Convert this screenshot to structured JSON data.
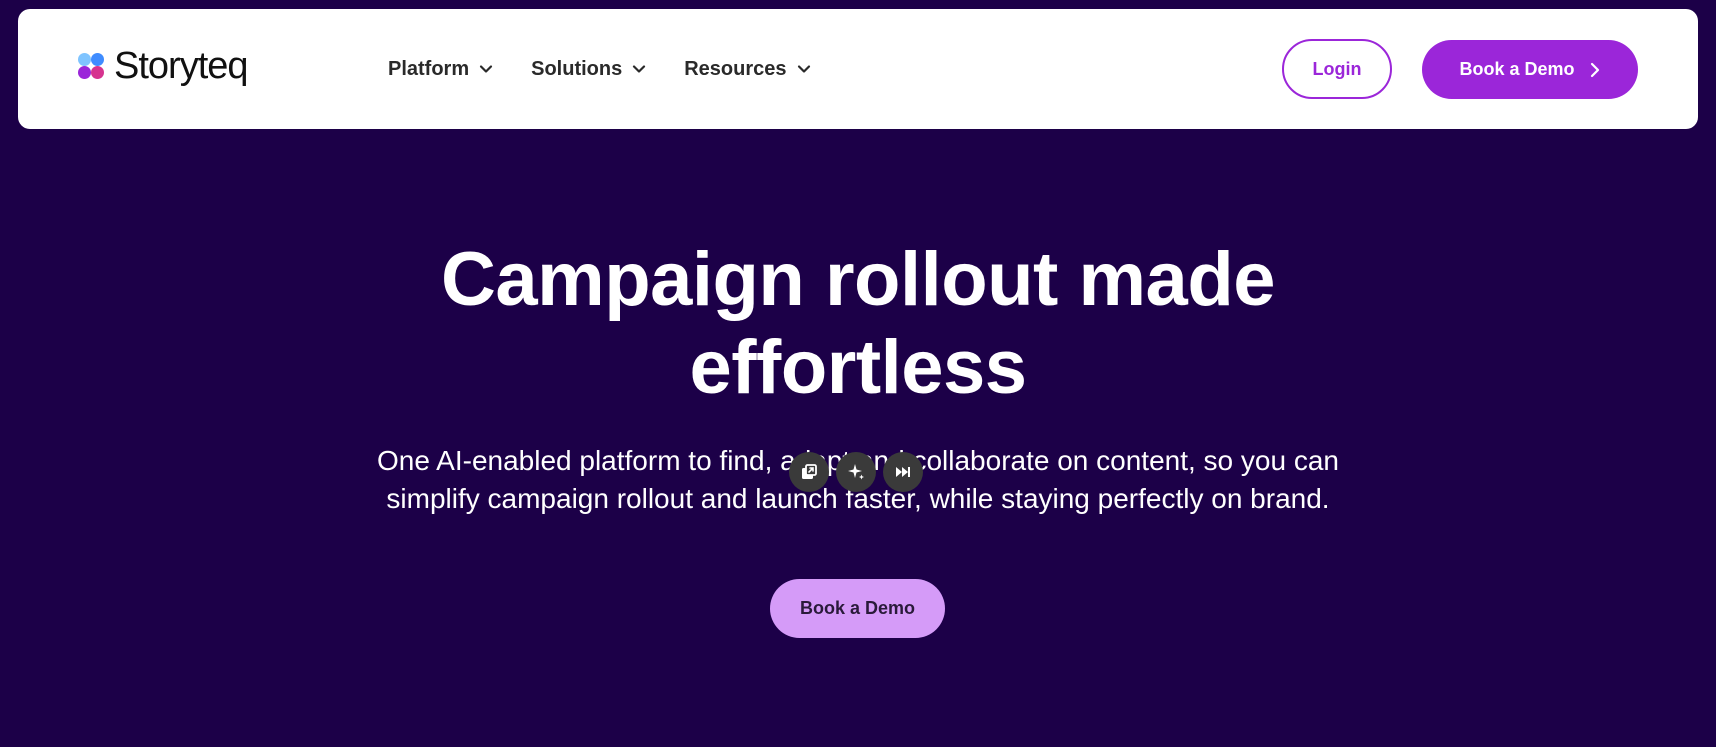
{
  "brand": {
    "name": "Storyteq"
  },
  "nav": {
    "items": [
      {
        "label": "Platform"
      },
      {
        "label": "Solutions"
      },
      {
        "label": "Resources"
      }
    ],
    "login_label": "Login",
    "demo_label": "Book a Demo"
  },
  "hero": {
    "title_line1": "Campaign rollout made",
    "title_line2": "effortless",
    "subtitle_line1": "One AI-enabled platform to find, adapt and collaborate on content, so you can",
    "subtitle_line2": "simplify campaign rollout and launch faster, while staying perfectly on brand.",
    "cta_label": "Book a Demo"
  },
  "media_controls": {
    "icons": [
      "picture-in-picture-icon",
      "sparkle-icon",
      "skip-forward-icon"
    ]
  },
  "colors": {
    "background": "#1c0048",
    "accent": "#9b26d9",
    "cta_light": "#d59bf8",
    "navbar": "#ffffff"
  }
}
